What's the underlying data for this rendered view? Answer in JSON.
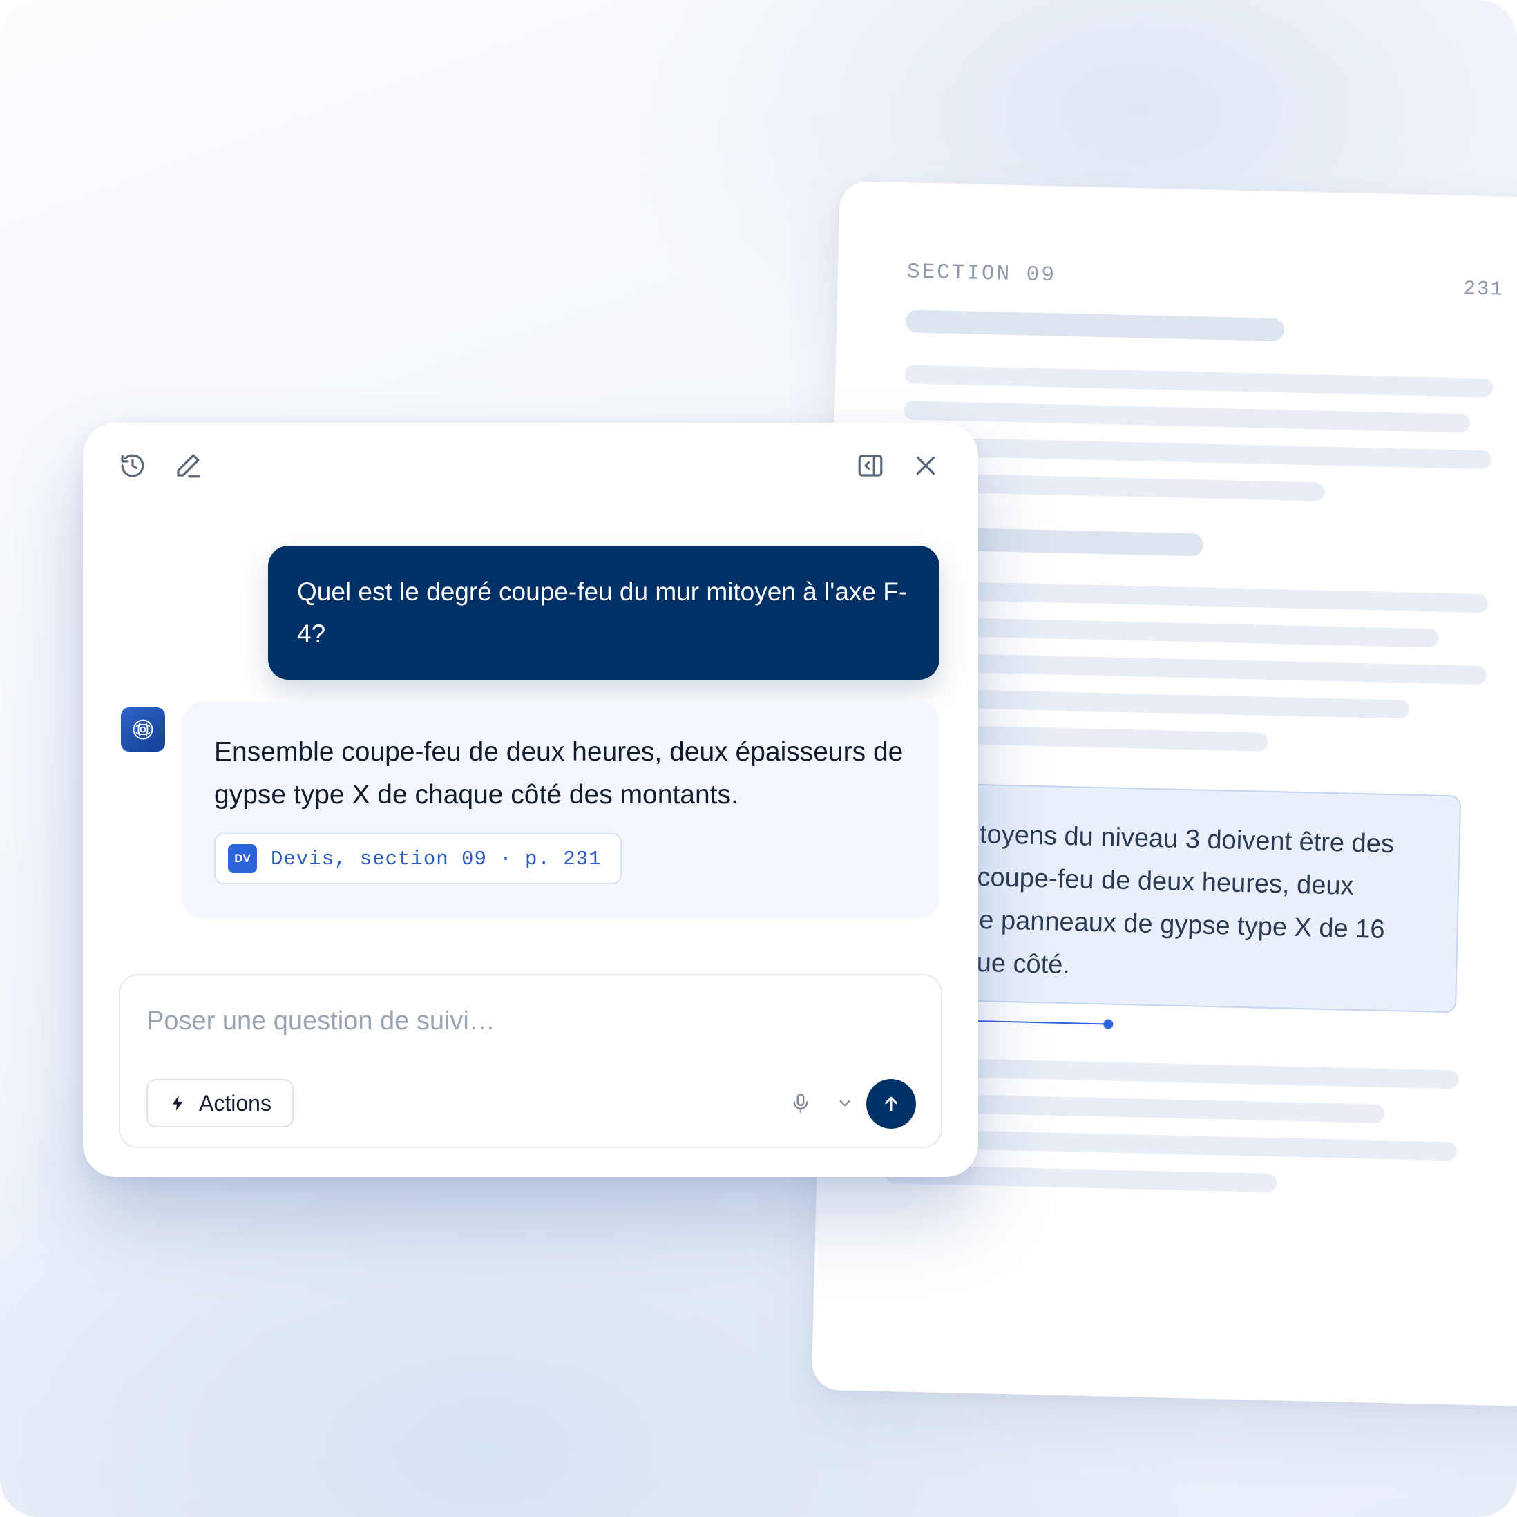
{
  "document": {
    "section_label": "SECTION 09",
    "page_number": "231",
    "highlight_lines": [
      "rs mitoyens du niveau 3 doivent être des",
      "bles coupe-feu de deux heures, deux",
      "urs de panneaux de gypse type X de 16",
      "chaque côté."
    ],
    "highlight_color": "#e9f0fc",
    "anchor_color": "#2f63db"
  },
  "chat": {
    "toolbar": {
      "history_icon": "history-icon",
      "new_chat_icon": "pencil-icon",
      "collapse_icon": "sidebar-collapse-icon",
      "close_icon": "close-icon"
    },
    "user_message": "Quel est le degré coupe-feu du mur mitoyen à l'axe F-4?",
    "assistant": {
      "avatar_icon": "assistant-logo-icon",
      "message": "Ensemble coupe-feu de deux heures, deux épaisseurs de gypse type X de chaque côté des montants.",
      "citation": {
        "badge": "DV",
        "text": "Devis, section 09 · p. 231"
      }
    },
    "composer": {
      "placeholder": "Poser une question de suivi…",
      "value": "",
      "actions_label": "Actions",
      "actions_icon": "lightning-icon",
      "mic_icon": "microphone-icon",
      "chevron_icon": "chevron-down-icon",
      "send_icon": "arrow-up-icon"
    },
    "colors": {
      "primary": "#003166",
      "accent": "#2b63d9",
      "assistant_bubble": "#f3f6fc"
    }
  }
}
